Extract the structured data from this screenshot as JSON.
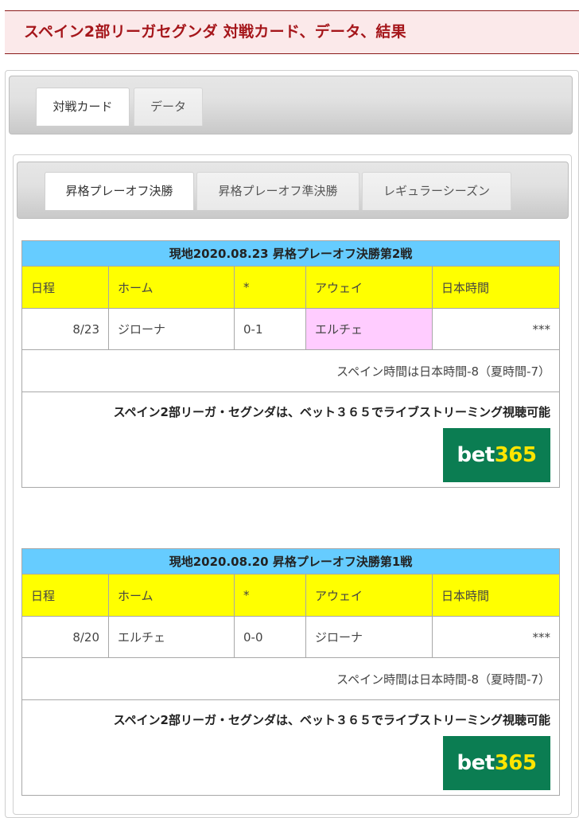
{
  "header": {
    "title": "スペイン2部リーガセグンダ 対戦カード、データ、結果"
  },
  "top_tabs": [
    {
      "label": "対戦カード",
      "active": true
    },
    {
      "label": "データ",
      "active": false
    }
  ],
  "sub_tabs": [
    {
      "label": "昇格プレーオフ決勝",
      "active": true
    },
    {
      "label": "昇格プレーオフ準決勝",
      "active": false
    },
    {
      "label": "レギュラーシーズン",
      "active": false
    }
  ],
  "columns": [
    "日程",
    "ホーム",
    "*",
    "アウェイ",
    "日本時間"
  ],
  "matches": [
    {
      "caption": "現地2020.08.23 昇格プレーオフ決勝第2戦",
      "date": "8/23",
      "home": "ジローナ",
      "score": "0-1",
      "away": "エルチェ",
      "jp_time": "***",
      "winner_side": "away",
      "note": "スペイン時間は日本時間-8（夏時間-7）",
      "promo": "スペイン2部リーガ・セグンダは、ベット３６５でライブストリーミング視聴可能",
      "logo": {
        "word": "bet",
        "number": "365"
      }
    },
    {
      "caption": "現地2020.08.20 昇格プレーオフ決勝第1戦",
      "date": "8/20",
      "home": "エルチェ",
      "score": "0-0",
      "away": "ジローナ",
      "jp_time": "***",
      "winner_side": "none",
      "note": "スペイン時間は日本時間-8（夏時間-7）",
      "promo": "スペイン2部リーガ・セグンダは、ベット３６５でライブストリーミング視聴可能",
      "logo": {
        "word": "bet",
        "number": "365"
      }
    }
  ],
  "colors": {
    "title_text": "#a5161b",
    "caption_bg": "#66ccff",
    "header_bg": "#ffff00",
    "winner_bg": "#ffccff",
    "logo_bg": "#0b7d52",
    "logo_number": "#ffe500"
  }
}
